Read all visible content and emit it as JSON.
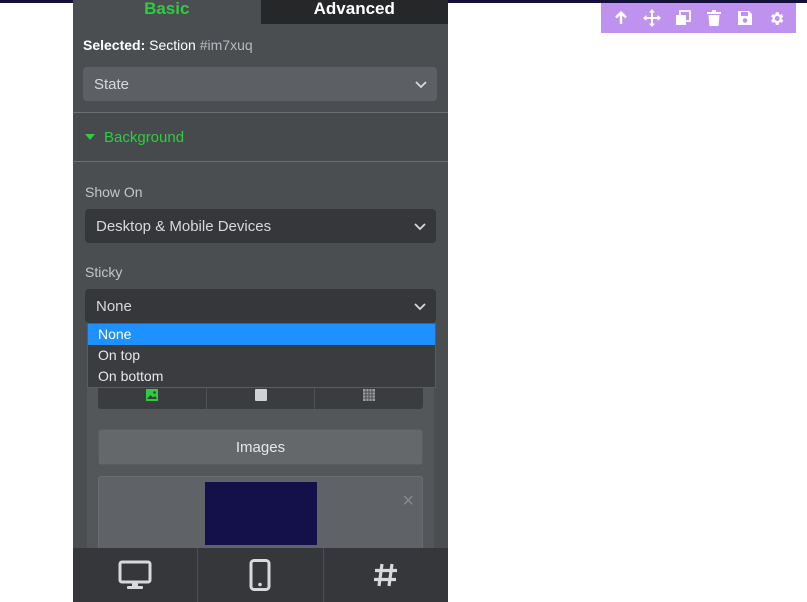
{
  "tabs": {
    "basic": "Basic",
    "advanced": "Advanced"
  },
  "selected": {
    "prefix": "Selected:",
    "name": "Section",
    "id": "#im7xuq"
  },
  "state_select": {
    "value": "State"
  },
  "section": {
    "title": "Background"
  },
  "show_on": {
    "label": "Show On",
    "value": "Desktop & Mobile Devices"
  },
  "sticky": {
    "label": "Sticky",
    "value": "None",
    "options": [
      "None",
      "On top",
      "On bottom"
    ]
  },
  "background": {
    "images_label": "Images",
    "type_icons": [
      "image-icon",
      "color-swatch-icon",
      "gradient-icon"
    ]
  },
  "bottom_bar": {
    "icons": [
      "desktop-icon",
      "mobile-icon",
      "hash-icon"
    ]
  },
  "toolbar": {
    "icons": [
      "arrow-up-icon",
      "move-icon",
      "clone-icon",
      "trash-icon",
      "save-icon",
      "gear-icon"
    ]
  },
  "colors": {
    "accent": "#2ecc40",
    "toolbar": "#c092f0",
    "highlight": "#1e90ff"
  }
}
